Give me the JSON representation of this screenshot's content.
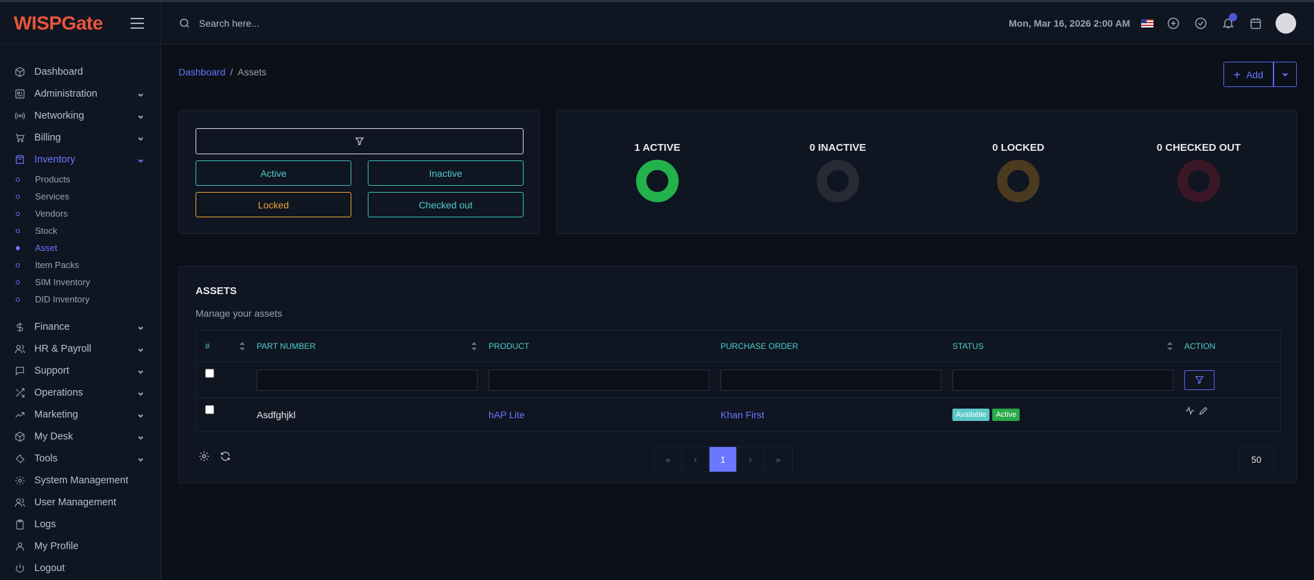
{
  "brand": {
    "logo": "WISPGate"
  },
  "search": {
    "placeholder": "Search here..."
  },
  "topbar": {
    "datetime": "Mon, Mar 16, 2026 2:00 AM"
  },
  "sidebar": {
    "items": [
      {
        "label": "Dashboard"
      },
      {
        "label": "Administration"
      },
      {
        "label": "Networking"
      },
      {
        "label": "Billing"
      },
      {
        "label": "Inventory"
      },
      {
        "label": "Finance"
      },
      {
        "label": "HR & Payroll"
      },
      {
        "label": "Support"
      },
      {
        "label": "Operations"
      },
      {
        "label": "Marketing"
      },
      {
        "label": "My Desk"
      },
      {
        "label": "Tools"
      },
      {
        "label": "System Management"
      },
      {
        "label": "User Management"
      },
      {
        "label": "Logs"
      },
      {
        "label": "My Profile"
      },
      {
        "label": "Logout"
      }
    ],
    "inventory_sub": [
      {
        "label": "Products"
      },
      {
        "label": "Services"
      },
      {
        "label": "Vendors"
      },
      {
        "label": "Stock"
      },
      {
        "label": "Asset"
      },
      {
        "label": "Item Packs"
      },
      {
        "label": "SIM Inventory"
      },
      {
        "label": "DID Inventory"
      }
    ]
  },
  "breadcrumb": {
    "home": "Dashboard",
    "sep": "/",
    "current": "Assets"
  },
  "actions": {
    "add_label": "Add"
  },
  "filters": {
    "active": "Active",
    "inactive": "Inactive",
    "locked": "Locked",
    "checked_out": "Checked out"
  },
  "stats": [
    {
      "label": "1 ACTIVE",
      "color": "#22b24c"
    },
    {
      "label": "0 INACTIVE",
      "color": "#262b36"
    },
    {
      "label": "0 LOCKED",
      "color": "#4a3a20"
    },
    {
      "label": "0 CHECKED OUT",
      "color": "#3b1627"
    }
  ],
  "assets": {
    "title": "ASSETS",
    "subtitle": "Manage your assets",
    "columns": {
      "num": "#",
      "part": "PART NUMBER",
      "product": "PRODUCT",
      "po": "PURCHASE ORDER",
      "status": "STATUS",
      "action": "ACTION"
    },
    "rows": [
      {
        "part": "Asdfghjkl",
        "product": "hAP Lite",
        "po": "Khan First",
        "status1": "Available",
        "status2": "Active"
      }
    ]
  },
  "pagination": {
    "first": "«",
    "prev": "‹",
    "current": "1",
    "next": "›",
    "last": "»",
    "page_size": "50"
  }
}
